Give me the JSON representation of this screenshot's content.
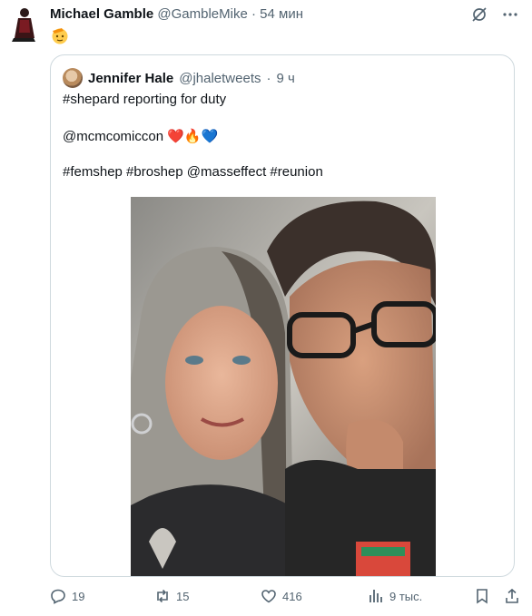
{
  "tweet": {
    "author_name": "Michael Gamble",
    "author_handle": "@GambleMike",
    "separator": "·",
    "time": "54 мин",
    "emoji": "🫡"
  },
  "quote": {
    "author_name": "Jennifer Hale",
    "author_handle": "@jhaletweets",
    "separator": "·",
    "time": "9 ч",
    "line1": "#shepard reporting for duty",
    "line2": "@mcmcomiccon ❤️🔥💙",
    "line3": "#femshep #broshep @masseffect #reunion"
  },
  "actions": {
    "replies": "19",
    "retweets": "15",
    "likes": "416",
    "views": "9 тыс."
  },
  "icons": [
    "grok-slash-icon",
    "more-icon",
    "reply-icon",
    "retweet-icon",
    "like-icon",
    "views-icon",
    "bookmark-icon",
    "share-icon"
  ],
  "colors": {
    "text": "#0f1419",
    "muted": "#536471",
    "border": "#cfd9de"
  }
}
